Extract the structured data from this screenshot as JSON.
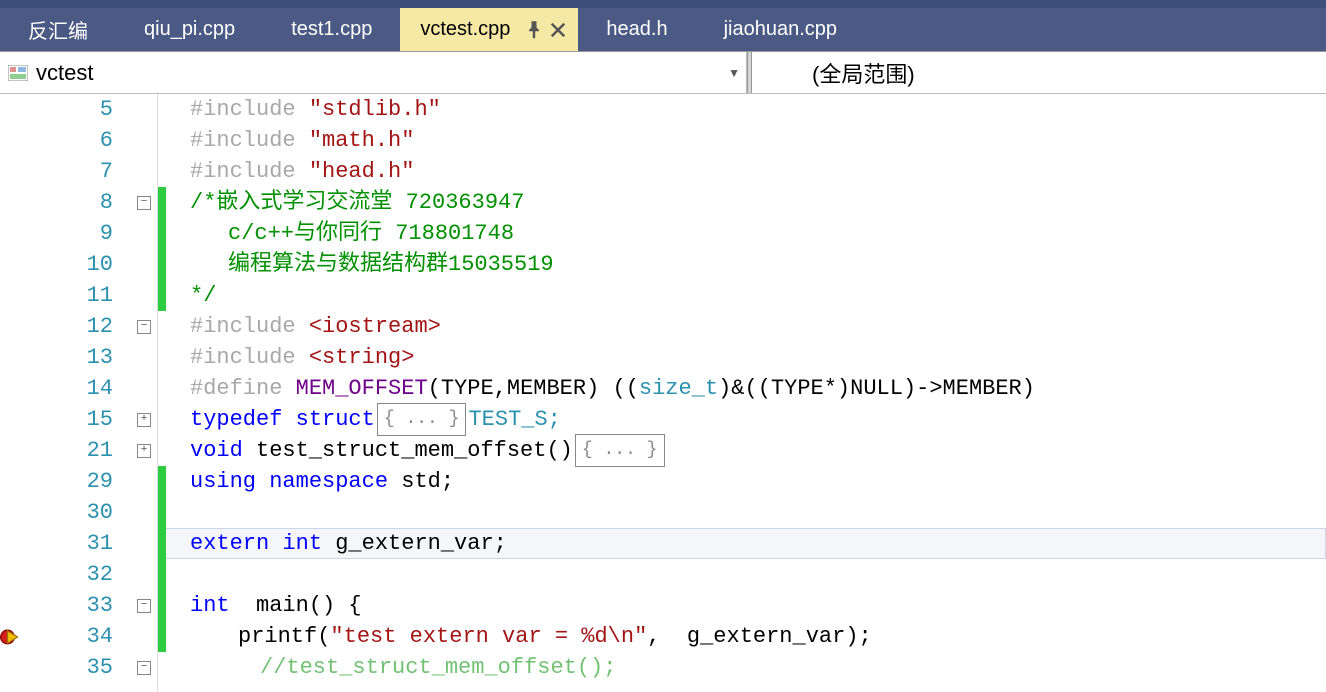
{
  "tabs": {
    "t0": "反汇编",
    "t1": "qiu_pi.cpp",
    "t2": "test1.cpp",
    "t3": "vctest.cpp",
    "t4": "head.h",
    "t5": "jiaohuan.cpp"
  },
  "filter": {
    "project": "vctest",
    "scope": "(全局范围)"
  },
  "lines": {
    "n5": "5",
    "n6": "6",
    "n7": "7",
    "n8": "8",
    "n9": "9",
    "n10": "10",
    "n11": "11",
    "n12": "12",
    "n13": "13",
    "n14": "14",
    "n15": "15",
    "n21": "21",
    "n29": "29",
    "n30": "30",
    "n31": "31",
    "n32": "32",
    "n33": "33",
    "n34": "34",
    "n35": "35"
  },
  "collapsed_placeholder": "{ ... }",
  "code": {
    "inc_kw": "#include ",
    "inc1": "\"stdlib.h\"",
    "inc2": "\"math.h\"",
    "inc3": "\"head.h\"",
    "c8": "/*嵌入式学习交流堂 720363947",
    "c9": "c/c++与你同行 718801748",
    "c10": "编程算法与数据结构群15035519",
    "c11": "*/",
    "inc4": "<iostream>",
    "inc5": "<string>",
    "def_kw": "#define ",
    "def_name": "MEM_OFFSET",
    "def_args": "(TYPE,MEMBER) ((",
    "def_size_t": "size_t",
    "def_tail": ")&((TYPE*)NULL)->MEMBER)",
    "td_typedef": "typedef ",
    "td_struct": "struct",
    "td_tail": "TEST_S;",
    "fn_void": "void",
    "fn_name": " test_struct_mem_offset()",
    "using_kw": "using ",
    "namespace_kw": "namespace ",
    "std_id": "std;",
    "extern_kw": "extern ",
    "int_kw": "int ",
    "gvar": "g_extern_var;",
    "main_sig": " main() {",
    "printf_name": "printf(",
    "printf_str": "\"test extern var = %d\\n\"",
    "printf_tail": ",  g_extern_var);",
    "last_comment": "//test_struct_mem_offset();"
  }
}
